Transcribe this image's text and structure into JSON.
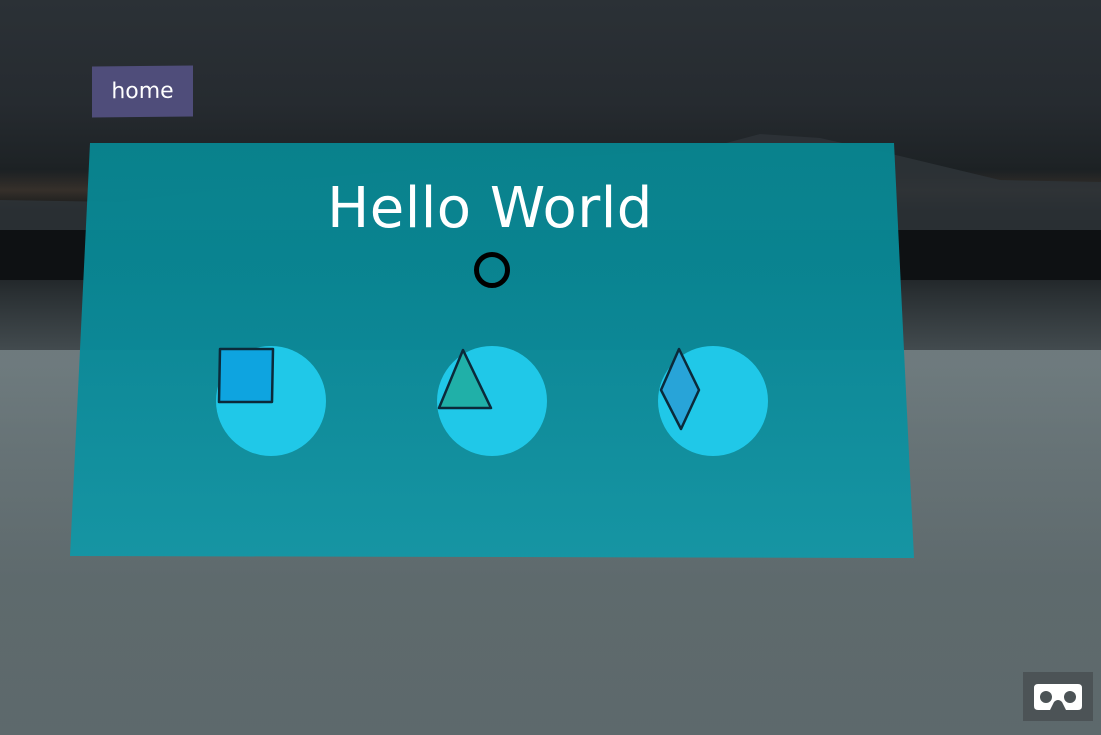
{
  "nav": {
    "home_label": "home"
  },
  "panel": {
    "title": "Hello World",
    "color": "#0e8a9a"
  },
  "shape_buttons": [
    {
      "shape": "square",
      "icon": "square-icon",
      "color": "#0ea4e0"
    },
    {
      "shape": "triangle",
      "icon": "triangle-icon",
      "color": "#20b0a8"
    },
    {
      "shape": "diamond",
      "icon": "diamond-icon",
      "color": "#28a4d8"
    }
  ],
  "vr": {
    "icon": "vr-headset-icon"
  },
  "colors": {
    "button_bg": "#20c8e8",
    "home_bg": "#4f4d7a",
    "vr_bg": "#4c5356"
  }
}
